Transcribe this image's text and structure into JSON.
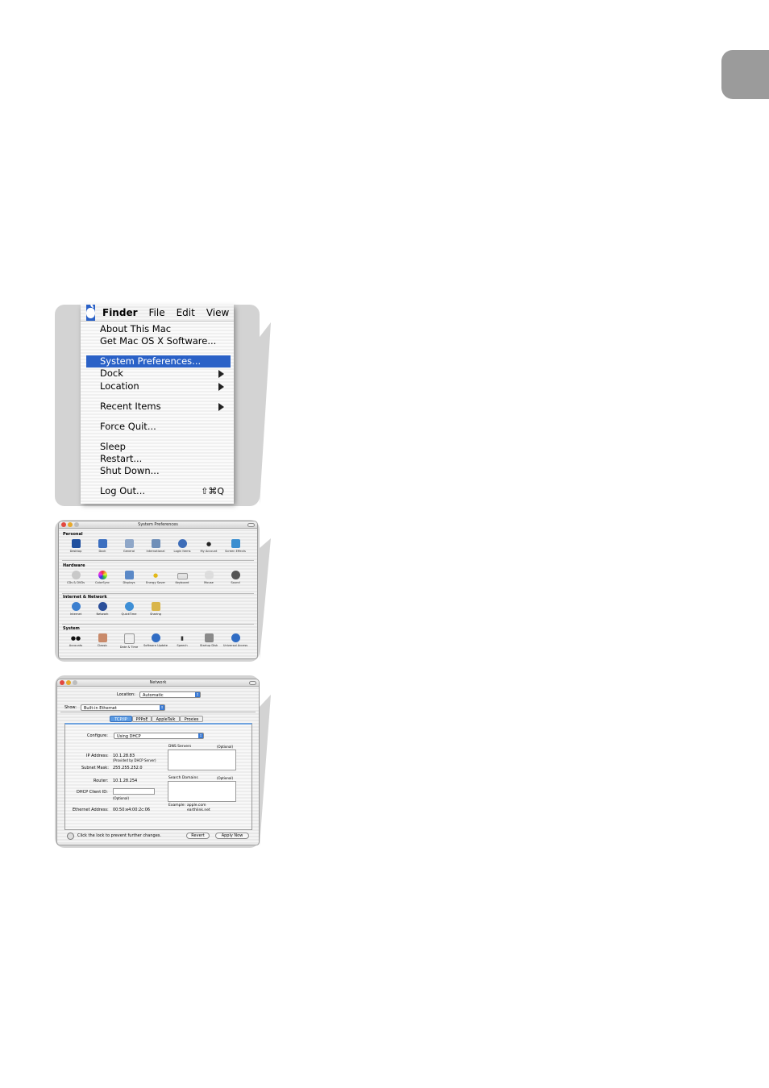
{
  "colors": {
    "accent": "#2a61c7",
    "panel_bg": "#d3d3d3",
    "side_tab": "#9b9b9b"
  },
  "apple_menu": {
    "menubar": [
      "Finder",
      "File",
      "Edit",
      "View"
    ],
    "items": [
      {
        "label": "About This Mac"
      },
      {
        "label": "Get Mac OS X Software..."
      },
      {
        "label": "System Preferences..."
      },
      {
        "label": "Dock"
      },
      {
        "label": "Location"
      },
      {
        "label": "Recent Items"
      },
      {
        "label": "Force Quit..."
      },
      {
        "label": "Sleep"
      },
      {
        "label": "Restart..."
      },
      {
        "label": "Shut Down..."
      },
      {
        "label": "Log Out...",
        "shortcut": "⇧⌘Q"
      }
    ]
  },
  "system_prefs": {
    "title": "System Preferences",
    "sections": [
      {
        "label": "Personal",
        "items": [
          "Desktop",
          "Dock",
          "General",
          "International",
          "Login Items",
          "My Account",
          "Screen Effects"
        ]
      },
      {
        "label": "Hardware",
        "items": [
          "CDs & DVDs",
          "ColorSync",
          "Displays",
          "Energy Saver",
          "Keyboard",
          "Mouse",
          "Sound"
        ]
      },
      {
        "label": "Internet & Network",
        "items": [
          "Internet",
          "Network",
          "QuickTime",
          "Sharing"
        ]
      },
      {
        "label": "System",
        "items": [
          "Accounts",
          "Classic",
          "Date & Time",
          "Software Update",
          "Speech",
          "Startup Disk",
          "Universal Access"
        ]
      }
    ]
  },
  "network": {
    "title": "Network",
    "location_label": "Location:",
    "location_value": "Automatic",
    "show_label": "Show:",
    "show_value": "Built-in Ethernet",
    "tabs": [
      "TCP/IP",
      "PPPoE",
      "AppleTalk",
      "Proxies"
    ],
    "configure_label": "Configure:",
    "configure_value": "Using DHCP",
    "dns_label": "DNS Servers",
    "optional": "(Optional)",
    "search_label": "Search Domains",
    "ip_label": "IP Address:",
    "ip_value": "10.1.28.83",
    "ip_note": "(Provided by DHCP Server)",
    "subnet_label": "Subnet Mask:",
    "subnet_value": "255.255.252.0",
    "router_label": "Router:",
    "router_value": "10.1.28.254",
    "dhcp_label": "DHCP Client ID:",
    "dhcp_optional": "(Optional)",
    "ethernet_label": "Ethernet Address:",
    "ethernet_value": "00:50:e4:00:2c:06",
    "example_label": "Example:",
    "example_1": "apple.com",
    "example_2": "earthlink.net",
    "lock_text": "Click the lock to prevent further changes.",
    "revert": "Revert",
    "apply": "Apply Now"
  }
}
